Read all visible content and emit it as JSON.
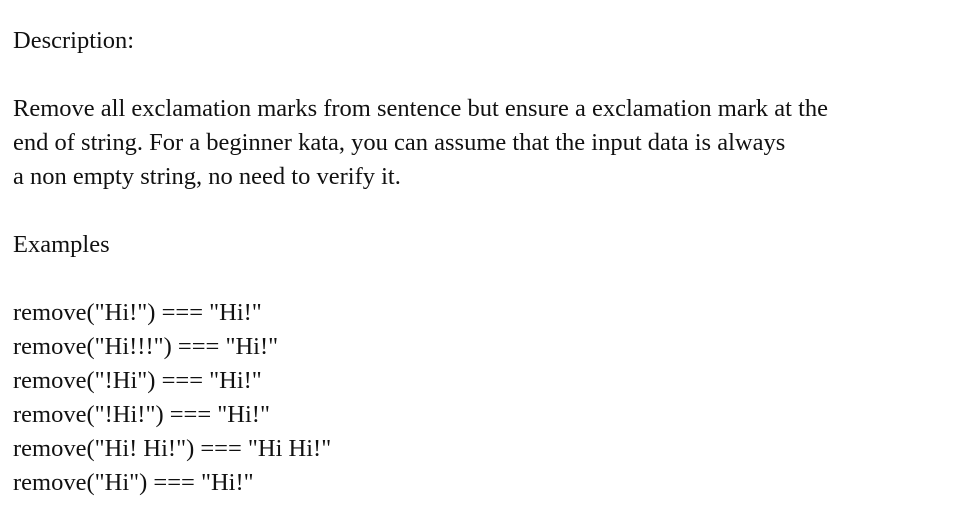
{
  "heading": "Description:",
  "description_lines": [
    "Remove all exclamation marks from sentence but ensure a exclamation mark at the",
    "end of string. For a beginner kata, you can assume that the input data is always",
    "a non empty string, no need to verify it."
  ],
  "examples_heading": "Examples",
  "examples": [
    "remove(\"Hi!\") === \"Hi!\"",
    "remove(\"Hi!!!\") === \"Hi!\"",
    "remove(\"!Hi\") === \"Hi!\"",
    "remove(\"!Hi!\") === \"Hi!\"",
    "remove(\"Hi! Hi!\") === \"Hi Hi!\"",
    "remove(\"Hi\") === \"Hi!\""
  ]
}
